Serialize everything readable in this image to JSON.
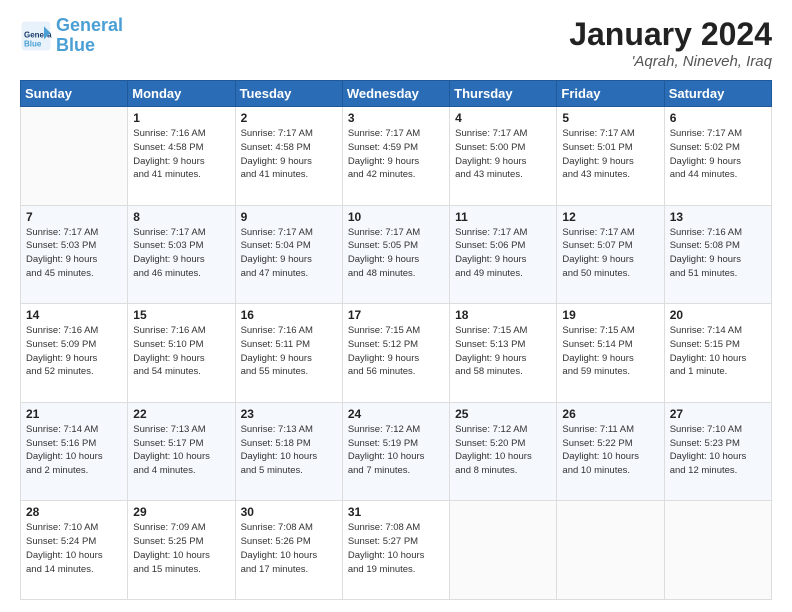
{
  "header": {
    "logo_line1": "General",
    "logo_line2": "Blue",
    "title": "January 2024",
    "subtitle": "'Aqrah, Nineveh, Iraq"
  },
  "weekdays": [
    "Sunday",
    "Monday",
    "Tuesday",
    "Wednesday",
    "Thursday",
    "Friday",
    "Saturday"
  ],
  "weeks": [
    [
      {
        "day": "",
        "info": ""
      },
      {
        "day": "1",
        "info": "Sunrise: 7:16 AM\nSunset: 4:58 PM\nDaylight: 9 hours\nand 41 minutes."
      },
      {
        "day": "2",
        "info": "Sunrise: 7:17 AM\nSunset: 4:58 PM\nDaylight: 9 hours\nand 41 minutes."
      },
      {
        "day": "3",
        "info": "Sunrise: 7:17 AM\nSunset: 4:59 PM\nDaylight: 9 hours\nand 42 minutes."
      },
      {
        "day": "4",
        "info": "Sunrise: 7:17 AM\nSunset: 5:00 PM\nDaylight: 9 hours\nand 43 minutes."
      },
      {
        "day": "5",
        "info": "Sunrise: 7:17 AM\nSunset: 5:01 PM\nDaylight: 9 hours\nand 43 minutes."
      },
      {
        "day": "6",
        "info": "Sunrise: 7:17 AM\nSunset: 5:02 PM\nDaylight: 9 hours\nand 44 minutes."
      }
    ],
    [
      {
        "day": "7",
        "info": "Sunrise: 7:17 AM\nSunset: 5:03 PM\nDaylight: 9 hours\nand 45 minutes."
      },
      {
        "day": "8",
        "info": "Sunrise: 7:17 AM\nSunset: 5:03 PM\nDaylight: 9 hours\nand 46 minutes."
      },
      {
        "day": "9",
        "info": "Sunrise: 7:17 AM\nSunset: 5:04 PM\nDaylight: 9 hours\nand 47 minutes."
      },
      {
        "day": "10",
        "info": "Sunrise: 7:17 AM\nSunset: 5:05 PM\nDaylight: 9 hours\nand 48 minutes."
      },
      {
        "day": "11",
        "info": "Sunrise: 7:17 AM\nSunset: 5:06 PM\nDaylight: 9 hours\nand 49 minutes."
      },
      {
        "day": "12",
        "info": "Sunrise: 7:17 AM\nSunset: 5:07 PM\nDaylight: 9 hours\nand 50 minutes."
      },
      {
        "day": "13",
        "info": "Sunrise: 7:16 AM\nSunset: 5:08 PM\nDaylight: 9 hours\nand 51 minutes."
      }
    ],
    [
      {
        "day": "14",
        "info": "Sunrise: 7:16 AM\nSunset: 5:09 PM\nDaylight: 9 hours\nand 52 minutes."
      },
      {
        "day": "15",
        "info": "Sunrise: 7:16 AM\nSunset: 5:10 PM\nDaylight: 9 hours\nand 54 minutes."
      },
      {
        "day": "16",
        "info": "Sunrise: 7:16 AM\nSunset: 5:11 PM\nDaylight: 9 hours\nand 55 minutes."
      },
      {
        "day": "17",
        "info": "Sunrise: 7:15 AM\nSunset: 5:12 PM\nDaylight: 9 hours\nand 56 minutes."
      },
      {
        "day": "18",
        "info": "Sunrise: 7:15 AM\nSunset: 5:13 PM\nDaylight: 9 hours\nand 58 minutes."
      },
      {
        "day": "19",
        "info": "Sunrise: 7:15 AM\nSunset: 5:14 PM\nDaylight: 9 hours\nand 59 minutes."
      },
      {
        "day": "20",
        "info": "Sunrise: 7:14 AM\nSunset: 5:15 PM\nDaylight: 10 hours\nand 1 minute."
      }
    ],
    [
      {
        "day": "21",
        "info": "Sunrise: 7:14 AM\nSunset: 5:16 PM\nDaylight: 10 hours\nand 2 minutes."
      },
      {
        "day": "22",
        "info": "Sunrise: 7:13 AM\nSunset: 5:17 PM\nDaylight: 10 hours\nand 4 minutes."
      },
      {
        "day": "23",
        "info": "Sunrise: 7:13 AM\nSunset: 5:18 PM\nDaylight: 10 hours\nand 5 minutes."
      },
      {
        "day": "24",
        "info": "Sunrise: 7:12 AM\nSunset: 5:19 PM\nDaylight: 10 hours\nand 7 minutes."
      },
      {
        "day": "25",
        "info": "Sunrise: 7:12 AM\nSunset: 5:20 PM\nDaylight: 10 hours\nand 8 minutes."
      },
      {
        "day": "26",
        "info": "Sunrise: 7:11 AM\nSunset: 5:22 PM\nDaylight: 10 hours\nand 10 minutes."
      },
      {
        "day": "27",
        "info": "Sunrise: 7:10 AM\nSunset: 5:23 PM\nDaylight: 10 hours\nand 12 minutes."
      }
    ],
    [
      {
        "day": "28",
        "info": "Sunrise: 7:10 AM\nSunset: 5:24 PM\nDaylight: 10 hours\nand 14 minutes."
      },
      {
        "day": "29",
        "info": "Sunrise: 7:09 AM\nSunset: 5:25 PM\nDaylight: 10 hours\nand 15 minutes."
      },
      {
        "day": "30",
        "info": "Sunrise: 7:08 AM\nSunset: 5:26 PM\nDaylight: 10 hours\nand 17 minutes."
      },
      {
        "day": "31",
        "info": "Sunrise: 7:08 AM\nSunset: 5:27 PM\nDaylight: 10 hours\nand 19 minutes."
      },
      {
        "day": "",
        "info": ""
      },
      {
        "day": "",
        "info": ""
      },
      {
        "day": "",
        "info": ""
      }
    ]
  ]
}
